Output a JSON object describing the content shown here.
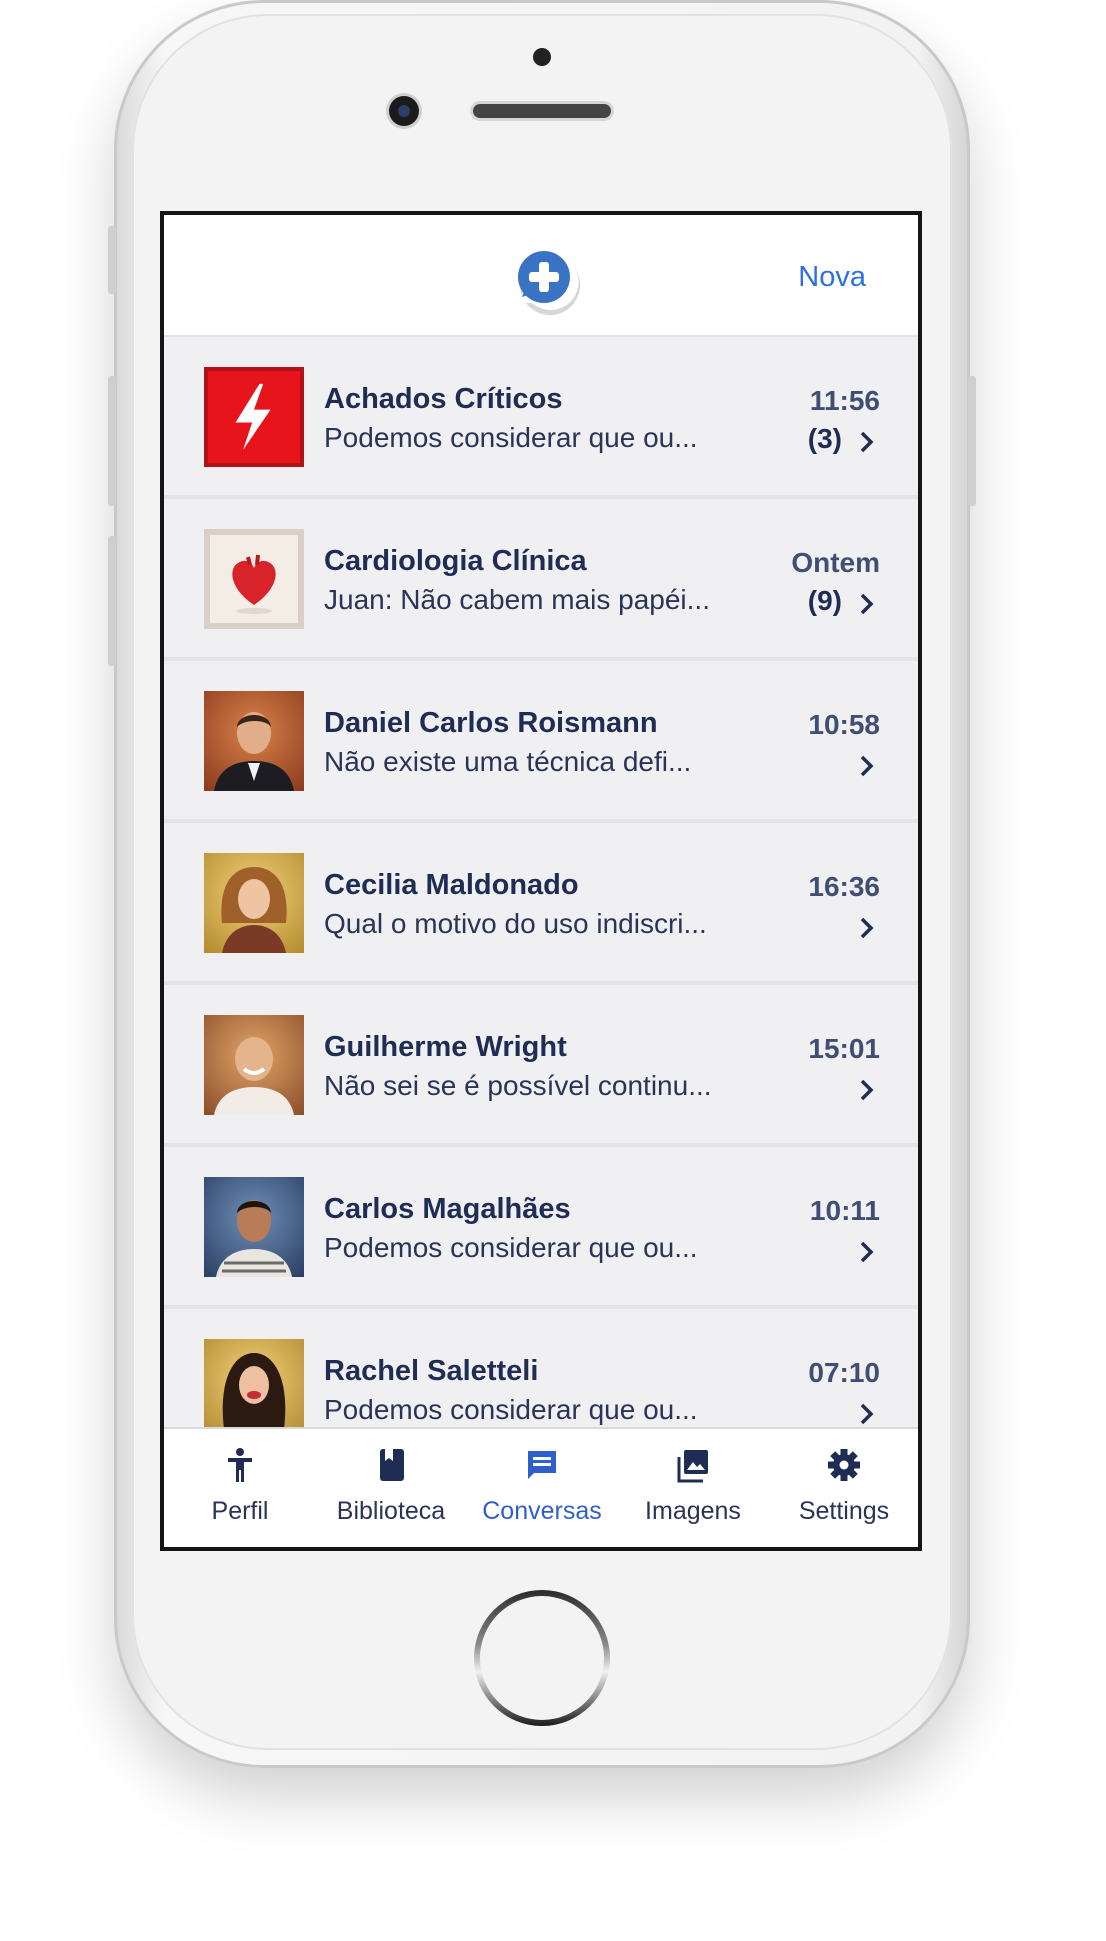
{
  "header": {
    "new_label": "Nova"
  },
  "conversations": [
    {
      "name": "Achados Críticos",
      "preview": "Podemos considerar que ou...",
      "time": "11:56",
      "count": "(3)",
      "avatar": "alert-bolt-icon"
    },
    {
      "name": "Cardiologia Clínica",
      "preview": "Juan: Não cabem mais papéi...",
      "time": "Ontem",
      "count": "(9)",
      "avatar": "heart-icon"
    },
    {
      "name": "Daniel Carlos Roismann",
      "preview": "Não existe uma técnica defi...",
      "time": "10:58",
      "count": "",
      "avatar": "person-photo"
    },
    {
      "name": "Cecilia Maldonado",
      "preview": "Qual o motivo do uso indiscri...",
      "time": "16:36",
      "count": "",
      "avatar": "person-photo"
    },
    {
      "name": "Guilherme Wright",
      "preview": "Não sei se é possível continu...",
      "time": "15:01",
      "count": "",
      "avatar": "person-photo"
    },
    {
      "name": "Carlos Magalhães",
      "preview": "Podemos considerar que ou...",
      "time": "10:11",
      "count": "",
      "avatar": "person-photo"
    },
    {
      "name": "Rachel Saletteli",
      "preview": "Podemos considerar que ou...",
      "time": "07:10",
      "count": "",
      "avatar": "person-photo"
    }
  ],
  "tabs": [
    {
      "label": "Perfil",
      "icon": "person-icon"
    },
    {
      "label": "Biblioteca",
      "icon": "book-icon"
    },
    {
      "label": "Conversas",
      "icon": "chat-icon",
      "active": true
    },
    {
      "label": "Imagens",
      "icon": "images-icon"
    },
    {
      "label": "Settings",
      "icon": "gear-icon"
    }
  ],
  "colors": {
    "accent": "#2f5fc8",
    "text_dark": "#1f2d55",
    "alert_red": "#e8141b"
  }
}
